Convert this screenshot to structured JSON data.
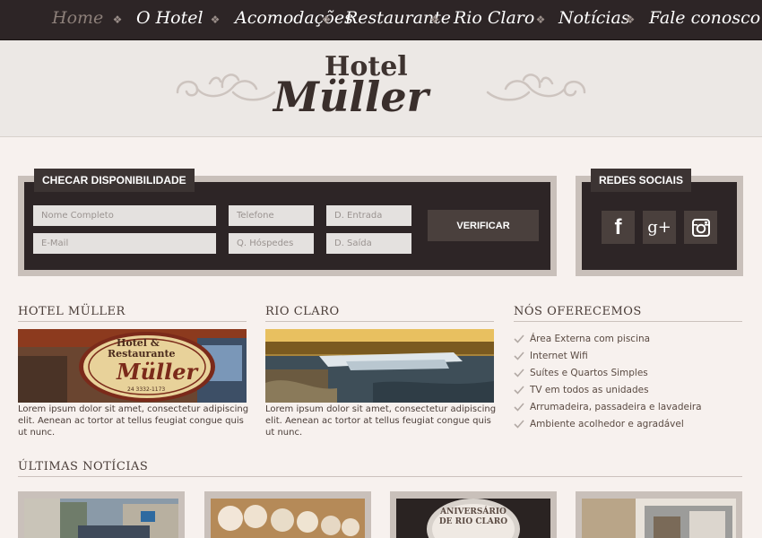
{
  "nav": {
    "items": [
      {
        "label": "Home",
        "active": true
      },
      {
        "label": "O Hotel",
        "active": false
      },
      {
        "label": "Acomodações",
        "active": false
      },
      {
        "label": "Restaurante",
        "active": false
      },
      {
        "label": "Rio Claro",
        "active": false
      },
      {
        "label": "Notícias",
        "active": false
      },
      {
        "label": "Fale conosco",
        "active": false
      }
    ]
  },
  "header": {
    "logo_line1": "Hotel",
    "logo_line2": "Müller"
  },
  "booking": {
    "title": "CHECAR DISPONIBILIDADE",
    "fields": {
      "name_placeholder": "Nome Completo",
      "phone_placeholder": "Telefone",
      "checkin_placeholder": "D. Entrada",
      "email_placeholder": "E-Mail",
      "guests_placeholder": "Q. Hóspedes",
      "checkout_placeholder": "D. Saída"
    },
    "button_label": "VERIFICAR"
  },
  "social": {
    "title": "REDES SOCIAIS",
    "icons": [
      "facebook-icon",
      "google-plus-icon",
      "instagram-icon"
    ],
    "facebook_glyph": "f",
    "gplus_glyph": "g+"
  },
  "hotel_section": {
    "title": "HOTEL MÜLLER",
    "sign_line1": "Hotel &",
    "sign_line2": "Restaurante",
    "sign_line3": "Müller",
    "sign_phone": "24 3332-1173",
    "text": "Lorem ipsum dolor sit amet, consectetur adipiscing elit. Aenean ac tortor at tellus feugiat congue quis ut nunc."
  },
  "rio_section": {
    "title": "RIO CLARO",
    "text": "Lorem ipsum dolor sit amet, consectetur adipiscing elit. Aenean ac tortor at tellus feugiat congue quis ut nunc."
  },
  "offers_section": {
    "title": "NÓS OFERECEMOS",
    "items": [
      "Área Externa com piscina",
      "Internet Wifi",
      "Suítes e Quartos Simples",
      "TV em todos as unidades",
      "Arrumadeira, passadeira e lavadeira",
      "Ambiente acolhedor e agradável"
    ]
  },
  "news_section": {
    "title": "ÚLTIMAS NOTÍCIAS",
    "card3_text": "ANIVERSÁRIO DE RIO CLARO"
  },
  "colors": {
    "nav_bg": "#2d2526",
    "panel_bg": "#2d2526",
    "frame": "#c9c0ba",
    "button": "#4a403d",
    "page_bg": "#f7f1ee"
  }
}
